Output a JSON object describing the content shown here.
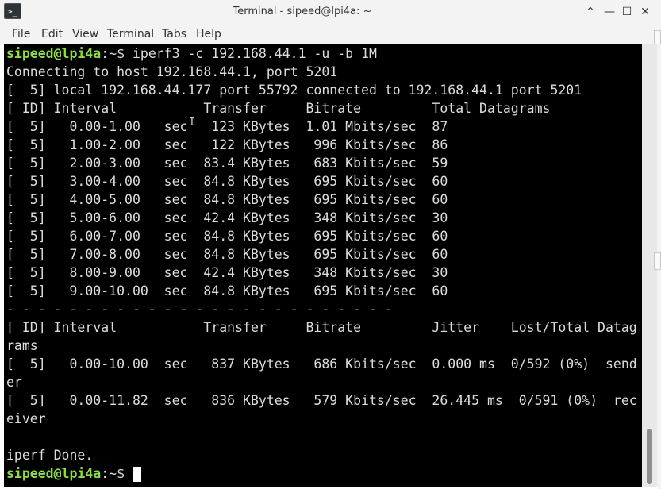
{
  "window": {
    "title": "Terminal - sipeed@lpi4a: ~",
    "icon": "terminal-icon",
    "controls": [
      {
        "name": "shade-button",
        "icon": "chevron-up-icon",
        "glyph": "⌃"
      },
      {
        "name": "minimize-button",
        "icon": "minimize-icon",
        "glyph": "—"
      },
      {
        "name": "maximize-button",
        "icon": "maximize-icon",
        "glyph": "☐"
      },
      {
        "name": "close-button",
        "icon": "close-icon",
        "glyph": "✕"
      }
    ]
  },
  "menubar": {
    "items": [
      "File",
      "Edit",
      "View",
      "Terminal",
      "Tabs",
      "Help"
    ]
  },
  "terminal": {
    "prompt_user": "sipeed@lpi4a",
    "prompt_suffix": ":~$ ",
    "command": "iperf3 -c 192.168.44.1 -u -b 1M",
    "output_lines": [
      "Connecting to host 192.168.44.1, port 5201",
      "[  5] local 192.168.44.177 port 55792 connected to 192.168.44.1 port 5201",
      "[ ID] Interval           Transfer     Bitrate         Total Datagrams",
      "[  5]   0.00-1.00   sec   123 KBytes  1.01 Mbits/sec  87",
      "[  5]   1.00-2.00   sec   122 KBytes   996 Kbits/sec  86",
      "[  5]   2.00-3.00   sec  83.4 KBytes   683 Kbits/sec  59",
      "[  5]   3.00-4.00   sec  84.8 KBytes   695 Kbits/sec  60",
      "[  5]   4.00-5.00   sec  84.8 KBytes   695 Kbits/sec  60",
      "[  5]   5.00-6.00   sec  42.4 KBytes   348 Kbits/sec  30",
      "[  5]   6.00-7.00   sec  84.8 KBytes   695 Kbits/sec  60",
      "[  5]   7.00-8.00   sec  84.8 KBytes   695 Kbits/sec  60",
      "[  5]   8.00-9.00   sec  42.4 KBytes   348 Kbits/sec  30",
      "[  5]   9.00-10.00  sec  84.8 KBytes   695 Kbits/sec  60",
      "- - - - - - - - - - - - - - - - - - - - - - - - -",
      "[ ID] Interval           Transfer     Bitrate         Jitter    Lost/Total Datag",
      "rams",
      "[  5]   0.00-10.00  sec   837 KBytes   686 Kbits/sec  0.000 ms  0/592 (0%)  send",
      "er",
      "[  5]   0.00-11.82  sec   836 KBytes   579 Kbits/sec  26.445 ms  0/591 (0%)  rec",
      "eiver",
      "",
      "iperf Done."
    ],
    "final_prompt_user": "sipeed@lpi4a",
    "final_prompt_suffix": ":~$ ",
    "colors": {
      "background": "#000000",
      "foreground": "#dcdcdc",
      "prompt_user": "#8ae234"
    },
    "scrollbar_position": 1.0
  }
}
